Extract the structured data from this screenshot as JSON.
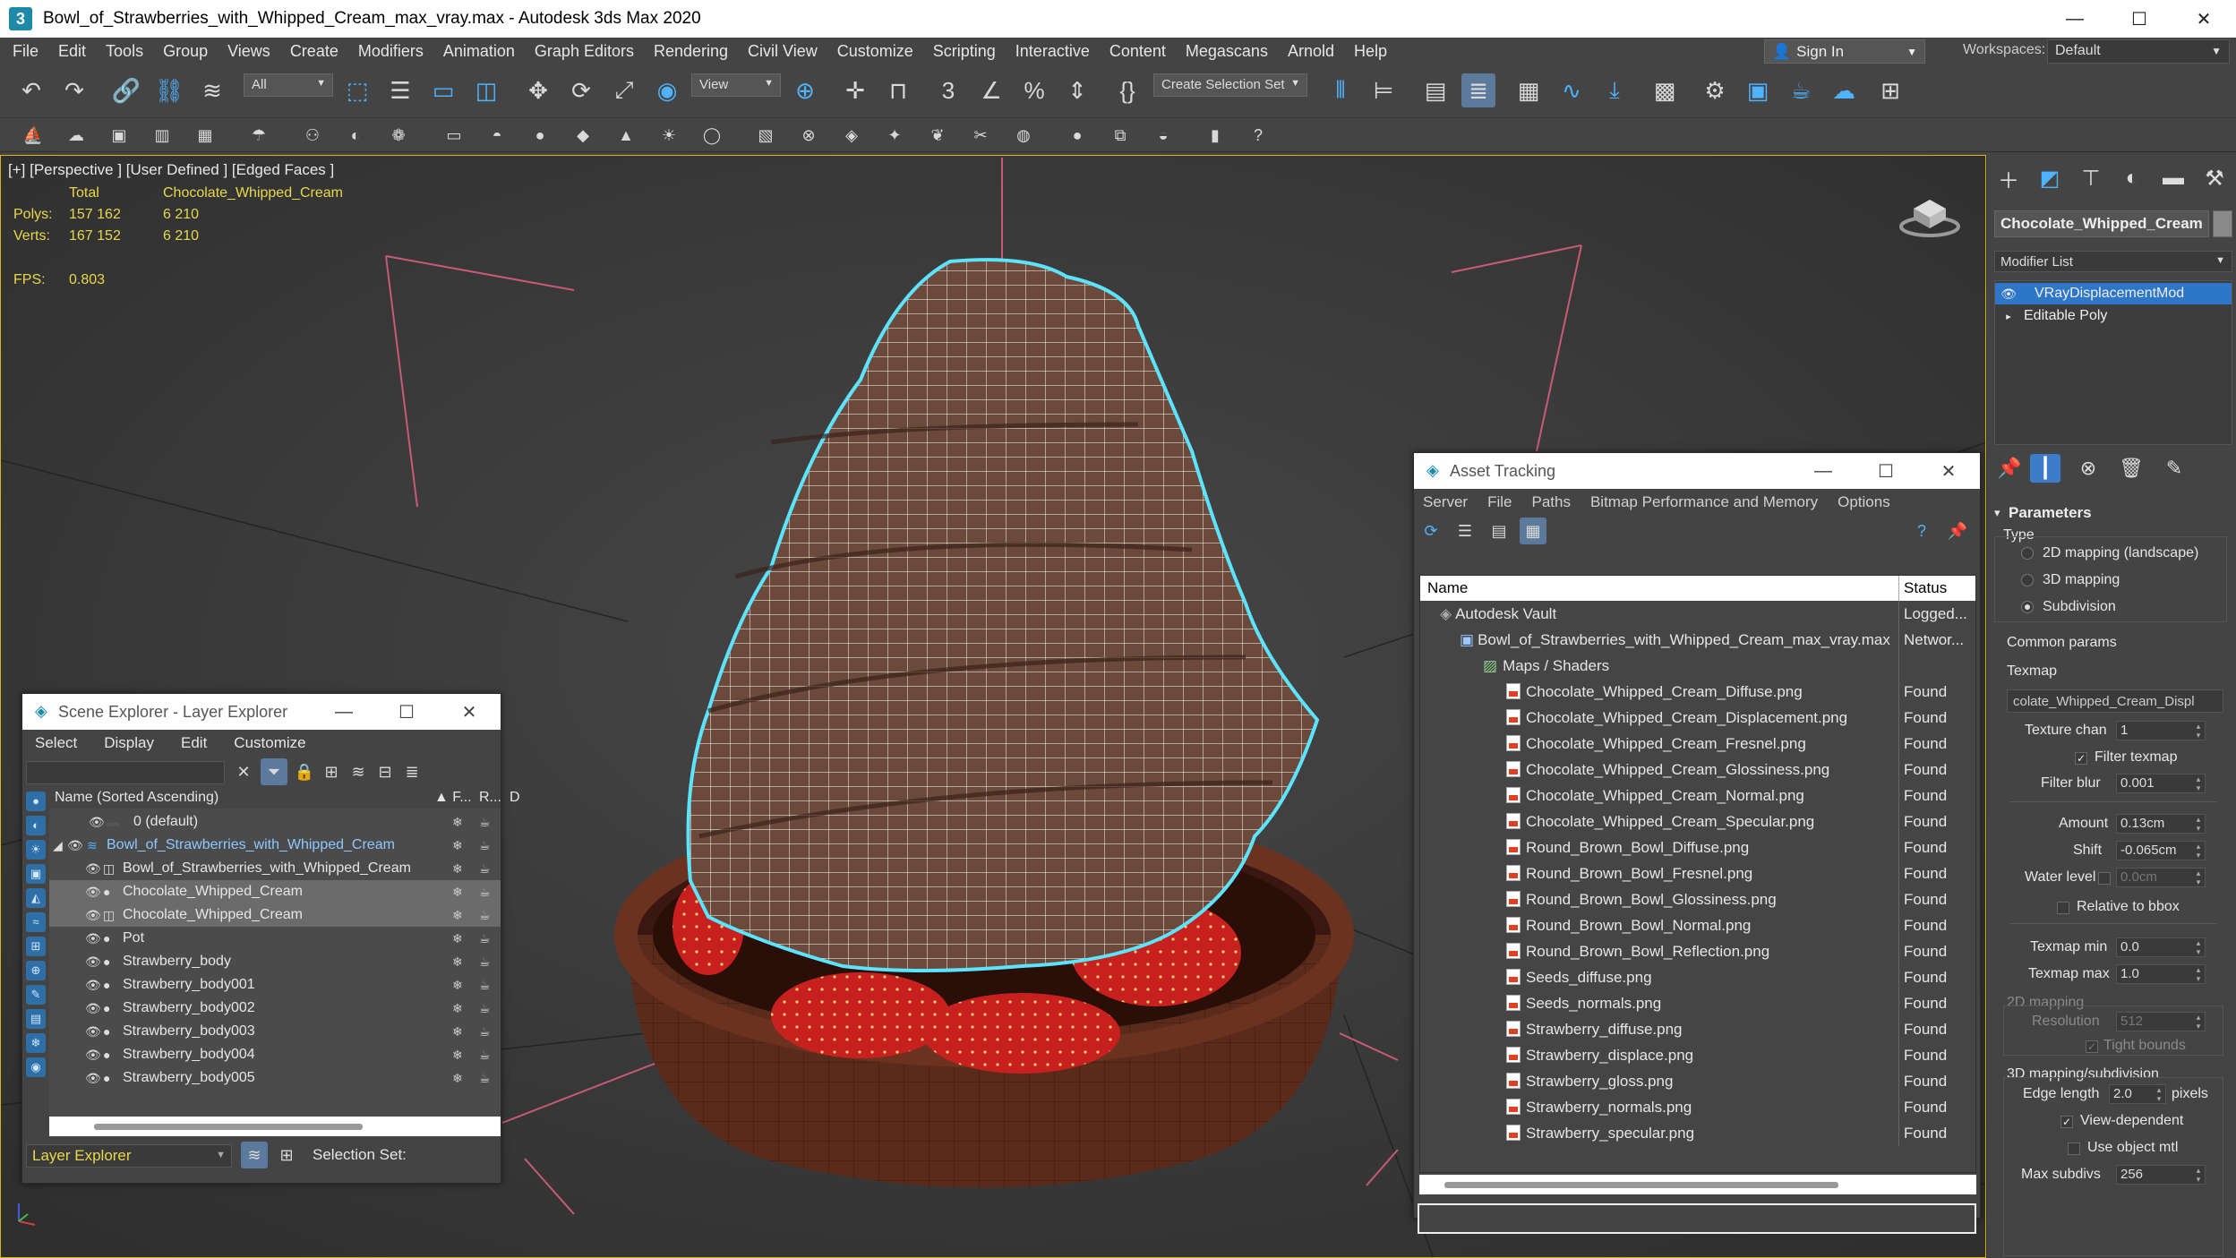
{
  "window": {
    "title": "Bowl_of_Strawberries_with_Whipped_Cream_max_vray.max - Autodesk 3ds Max 2020",
    "app_icon": "3"
  },
  "menu": [
    "File",
    "Edit",
    "Tools",
    "Group",
    "Views",
    "Create",
    "Modifiers",
    "Animation",
    "Graph Editors",
    "Rendering",
    "Civil View",
    "Customize",
    "Scripting",
    "Interactive",
    "Content",
    "Megascans",
    "Arnold",
    "Help"
  ],
  "signin": {
    "label": "Sign In"
  },
  "workspaces": {
    "label": "Workspaces:",
    "value": "Default"
  },
  "toolbar": {
    "filter_value": "All",
    "refcoord_value": "View",
    "selection_set_placeholder": "Create Selection Set"
  },
  "viewport": {
    "label": "[+] [Perspective ] [User Defined ] [Edged Faces ]",
    "stats_header_total": "Total",
    "stats_header_object": "Chocolate_Whipped_Cream",
    "polys_label": "Polys:",
    "polys_total": "157 162",
    "polys_object": "6 210",
    "verts_label": "Verts:",
    "verts_total": "167 152",
    "verts_object": "6 210",
    "fps_label": "FPS:",
    "fps_value": "0.803"
  },
  "scene_explorer": {
    "title": "Scene Explorer - Layer Explorer",
    "menu": [
      "Select",
      "Display",
      "Edit",
      "Customize"
    ],
    "col_name": "Name (Sorted Ascending)",
    "col_frozen": "▲ F...",
    "col_render": "R...",
    "col_d": "D",
    "rows": [
      {
        "name": "0 (default)"
      },
      {
        "name": "Bowl_of_Strawberries_with_Whipped_Cream"
      },
      {
        "name": "Bowl_of_Strawberries_with_Whipped_Cream"
      },
      {
        "name": "Chocolate_Whipped_Cream"
      },
      {
        "name": "Chocolate_Whipped_Cream"
      },
      {
        "name": "Pot"
      },
      {
        "name": "Strawberry_body"
      },
      {
        "name": "Strawberry_body001"
      },
      {
        "name": "Strawberry_body002"
      },
      {
        "name": "Strawberry_body003"
      },
      {
        "name": "Strawberry_body004"
      },
      {
        "name": "Strawberry_body005"
      }
    ],
    "footer_dropdown": "Layer Explorer",
    "selection_set_label": "Selection Set:"
  },
  "asset_tracking": {
    "title": "Asset Tracking",
    "menu": [
      "Server",
      "File",
      "Paths",
      "Bitmap Performance and Memory",
      "Options"
    ],
    "col_name": "Name",
    "col_status": "Status",
    "rows": [
      {
        "name": "Autodesk Vault",
        "status": "Logged..."
      },
      {
        "name": "Bowl_of_Strawberries_with_Whipped_Cream_max_vray.max",
        "status": "Networ..."
      },
      {
        "name": "Maps / Shaders",
        "status": ""
      },
      {
        "name": "Chocolate_Whipped_Cream_Diffuse.png",
        "status": "Found"
      },
      {
        "name": "Chocolate_Whipped_Cream_Displacement.png",
        "status": "Found"
      },
      {
        "name": "Chocolate_Whipped_Cream_Fresnel.png",
        "status": "Found"
      },
      {
        "name": "Chocolate_Whipped_Cream_Glossiness.png",
        "status": "Found"
      },
      {
        "name": "Chocolate_Whipped_Cream_Normal.png",
        "status": "Found"
      },
      {
        "name": "Chocolate_Whipped_Cream_Specular.png",
        "status": "Found"
      },
      {
        "name": "Round_Brown_Bowl_Diffuse.png",
        "status": "Found"
      },
      {
        "name": "Round_Brown_Bowl_Fresnel.png",
        "status": "Found"
      },
      {
        "name": "Round_Brown_Bowl_Glossiness.png",
        "status": "Found"
      },
      {
        "name": "Round_Brown_Bowl_Normal.png",
        "status": "Found"
      },
      {
        "name": "Round_Brown_Bowl_Reflection.png",
        "status": "Found"
      },
      {
        "name": "Seeds_diffuse.png",
        "status": "Found"
      },
      {
        "name": "Seeds_normals.png",
        "status": "Found"
      },
      {
        "name": "Strawberry_diffuse.png",
        "status": "Found"
      },
      {
        "name": "Strawberry_displace.png",
        "status": "Found"
      },
      {
        "name": "Strawberry_gloss.png",
        "status": "Found"
      },
      {
        "name": "Strawberry_normals.png",
        "status": "Found"
      },
      {
        "name": "Strawberry_specular.png",
        "status": "Found"
      }
    ]
  },
  "command_panel": {
    "object_name": "Chocolate_Whipped_Cream",
    "modifier_list_label": "Modifier List",
    "stack": [
      "VRayDisplacementMod",
      "Editable Poly"
    ],
    "parameters_title": "Parameters",
    "type_label": "Type",
    "type_options": [
      "2D mapping (landscape)",
      "3D mapping",
      "Subdivision"
    ],
    "common_params_label": "Common params",
    "texmap_label": "Texmap",
    "texmap_value": "colate_Whipped_Cream_Displ",
    "texture_chan_label": "Texture chan",
    "texture_chan_value": "1",
    "filter_texmap_label": "Filter texmap",
    "filter_blur_label": "Filter blur",
    "filter_blur_value": "0.001",
    "amount_label": "Amount",
    "amount_value": "0.13cm",
    "shift_label": "Shift",
    "shift_value": "-0.065cm",
    "water_level_label": "Water level",
    "water_level_value": "0.0cm",
    "relative_bbox_label": "Relative to bbox",
    "texmap_min_label": "Texmap min",
    "texmap_min_value": "0.0",
    "texmap_max_label": "Texmap max",
    "texmap_max_value": "1.0",
    "mapping2d_label": "2D mapping",
    "resolution_label": "Resolution",
    "resolution_value": "512",
    "tight_bounds_label": "Tight bounds",
    "mapping3d_label": "3D mapping/subdivision",
    "edge_length_label": "Edge length",
    "edge_length_value": "2.0",
    "pixels_label": "pixels",
    "view_dependent_label": "View-dependent",
    "use_object_mtl_label": "Use object mtl",
    "max_subdivs_label": "Max subdivs",
    "max_subdivs_value": "256"
  },
  "colors": {
    "accent_selection": "#2d76c8",
    "stats_yellow": "#e8d84a",
    "viewport_bg": "#3b3b3b",
    "selection_outline": "#5ce4ff"
  }
}
